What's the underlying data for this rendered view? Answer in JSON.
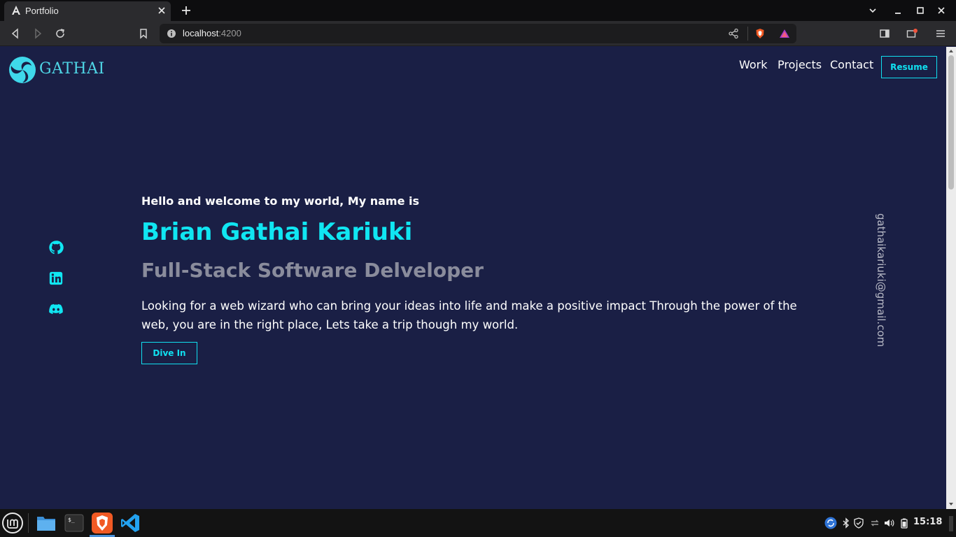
{
  "browser": {
    "tab_title": "Portfolio",
    "url_host": "localhost",
    "url_port": ":4200",
    "notification_count": "1"
  },
  "site": {
    "brand": "GATHAI",
    "nav": [
      "Work",
      "Projects",
      "Contact"
    ],
    "resume_label": "Resume",
    "social_icons": [
      "github-icon",
      "linkedin-icon",
      "discord-icon"
    ],
    "email": "gathaikariuki@gmail.com"
  },
  "hero": {
    "greeting": "Hello and welcome to my world, My name is",
    "name": "Brian Gathai Kariuki",
    "role": "Full-Stack Software Delveloper",
    "intro": "Looking for a web wizard who can bring your ideas into life and make a positive impact Through the power of the web, you are in the right place, Lets take a trip though my world.",
    "cta_label": "Dive In"
  },
  "taskbar": {
    "apps": [
      "files-icon",
      "terminal-icon",
      "brave-icon",
      "vscode-icon"
    ],
    "clock": "15:18"
  },
  "colors": {
    "page_bg": "#1a1f45",
    "accent": "#10e6f2",
    "muted": "#8a8c9c"
  }
}
